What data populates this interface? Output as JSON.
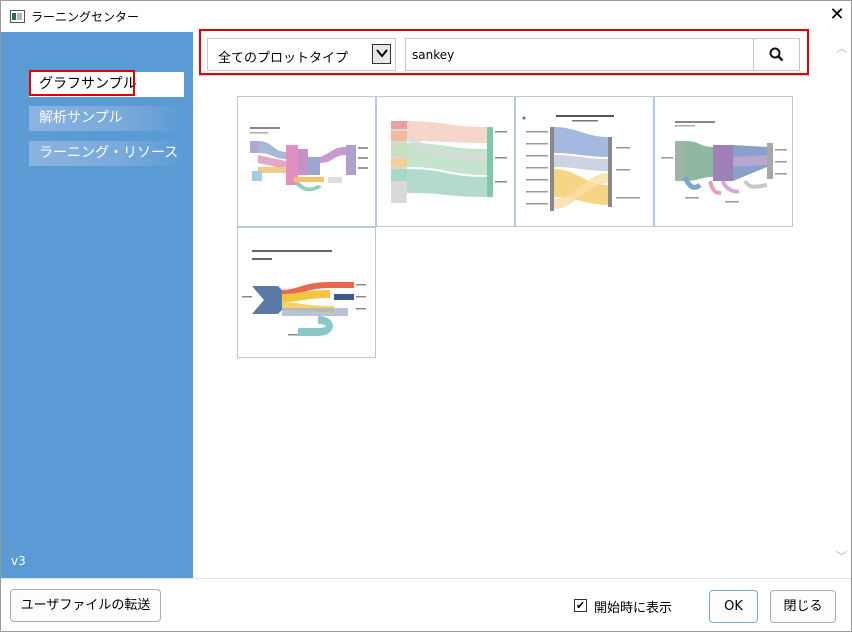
{
  "window": {
    "title": "ラーニングセンター"
  },
  "sidebar": {
    "items": [
      {
        "label": "グラフサンプル",
        "active": true
      },
      {
        "label": "解析サンプル",
        "active": false
      },
      {
        "label": "ラーニング・リソース",
        "active": false
      }
    ],
    "version": "v3"
  },
  "filter": {
    "plot_type_selected": "全てのプロットタイプ",
    "search_value": "sankey"
  },
  "thumbnails": [
    {
      "icon": "sankey-thumbnail-energy-flow"
    },
    {
      "icon": "sankey-thumbnail-many-nodes"
    },
    {
      "icon": "sankey-thumbnail-contributions"
    },
    {
      "icon": "sankey-thumbnail-energy-consumption"
    },
    {
      "icon": "sankey-thumbnail-water-energy"
    }
  ],
  "footer": {
    "transfer_button": "ユーザファイルの転送",
    "show_at_startup_label": "開始時に表示",
    "show_at_startup_checked": true,
    "ok_button": "OK",
    "close_button": "閉じる"
  },
  "colors": {
    "sidebar": "#5b9bd5",
    "highlight": "#e00000"
  }
}
